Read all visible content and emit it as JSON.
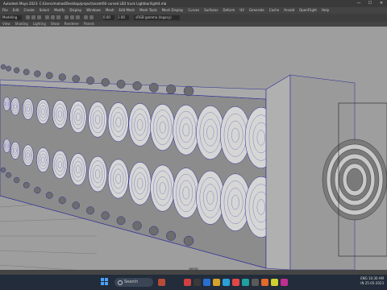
{
  "window": {
    "title": "Autodesk Maya 2023: C:/Users/mahad/Desktop/project/asset/60 curved LED truck Lightbar/light4.mb",
    "minimize": "—",
    "maximize": "☐",
    "close": "✕"
  },
  "menubar": {
    "items": [
      "File",
      "Edit",
      "Create",
      "Select",
      "Modify",
      "Display",
      "Windows",
      "Mesh",
      "Edit Mesh",
      "Mesh Tools",
      "Mesh Display",
      "Curves",
      "Surfaces",
      "Deform",
      "UV",
      "Generate",
      "Cache",
      "Arnold",
      "OpenFlight",
      "Help"
    ]
  },
  "shelf": {
    "mode": "Modeling",
    "field": "0.00",
    "field2": "1.00",
    "colorspace": "sRGB gamma (legacy)"
  },
  "panelmenu": {
    "items": [
      "View",
      "Shading",
      "Lighting",
      "Show",
      "Renderer",
      "Panels"
    ]
  },
  "viewport": {
    "camera_label": "persp",
    "background": "#9e9e9e",
    "wire_color": "#2a2a9a"
  },
  "taskbar": {
    "search_placeholder": "Search",
    "tray_lang": "ENG",
    "tray_region": "IN",
    "time": "10:30 AM",
    "date": "25-05-2023"
  }
}
